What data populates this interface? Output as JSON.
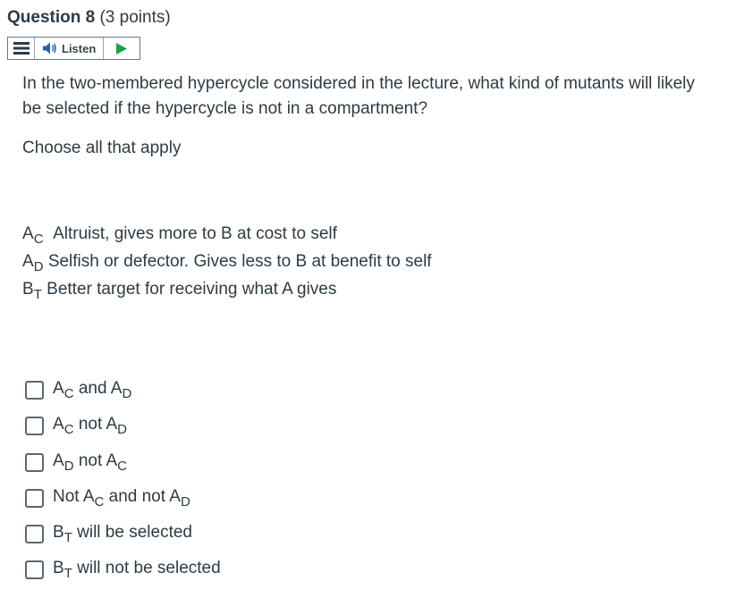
{
  "question": {
    "number_label": "Question 8",
    "points_label": "(3 points)"
  },
  "listen_bar": {
    "listen_label": "Listen",
    "icons": [
      "menu-icon",
      "speaker-icon",
      "play-icon"
    ],
    "accent_color": "#15a64a"
  },
  "prompt": {
    "text": "In the two-membered hypercycle considered in the lecture, what kind of mutants will likely be selected if the hypercycle is not in a compartment?",
    "instruction": "Choose all that apply"
  },
  "definitions": [
    {
      "base": "A",
      "sub": "C",
      "text": "Altruist, gives more to B at cost to self"
    },
    {
      "base": "A",
      "sub": "D",
      "text": "Selfish or defector. Gives less to B at benefit to self"
    },
    {
      "base": "B",
      "sub": "T",
      "text": "Better target for receiving what A gives"
    }
  ],
  "options": [
    {
      "p1": "",
      "b1": "A",
      "s1": "C",
      "mid": "and",
      "b2": "A",
      "s2": "D",
      "tail": "",
      "checked": false
    },
    {
      "p1": "",
      "b1": "A",
      "s1": "C",
      "mid": "not",
      "b2": "A",
      "s2": "D",
      "tail": "",
      "checked": false
    },
    {
      "p1": "",
      "b1": "A",
      "s1": "D",
      "mid": "not",
      "b2": "A",
      "s2": "C",
      "tail": "",
      "checked": false
    },
    {
      "p1": "Not",
      "b1": "A",
      "s1": "C",
      "mid": "and not",
      "b2": "A",
      "s2": "D",
      "tail": "",
      "checked": false
    },
    {
      "p1": "",
      "b1": "B",
      "s1": "T",
      "mid": "",
      "b2": "",
      "s2": "",
      "tail": "will be selected",
      "checked": false
    },
    {
      "p1": "",
      "b1": "B",
      "s1": "T",
      "mid": "",
      "b2": "",
      "s2": "",
      "tail": "will not be selected",
      "checked": false
    }
  ]
}
